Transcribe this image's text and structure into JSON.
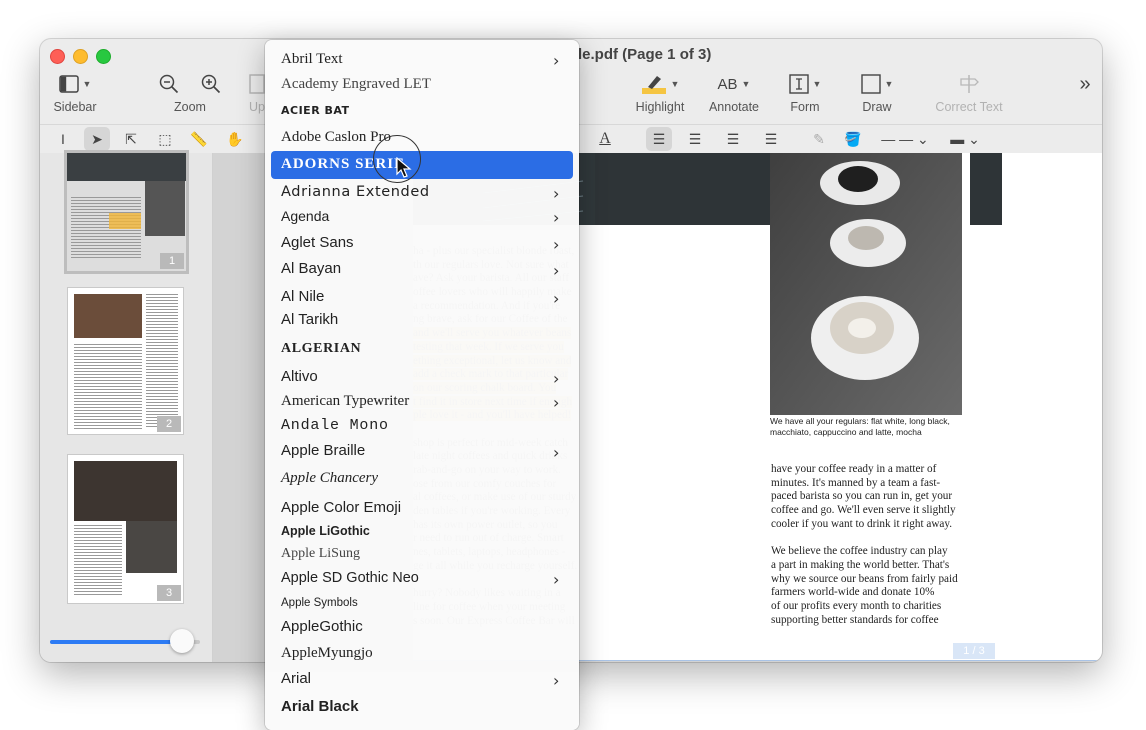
{
  "window": {
    "title": "le.pdf (Page 1 of 3)"
  },
  "toolbar": {
    "sidebar_label": "Sidebar",
    "zoom_label": "Zoom",
    "upload_label": "Up",
    "highlight_label": "Highlight",
    "annotate_label": "Annotate",
    "annotate_icon_text": "AB",
    "form_label": "Form",
    "draw_label": "Draw",
    "correct_text_label": "Correct Text",
    "more_icon": "»"
  },
  "colors": {
    "accent": "#2b6de5",
    "highlight": "#f7c64a",
    "dark_header": "#2e3437"
  },
  "thumbnails": [
    {
      "number": "1",
      "selected": true
    },
    {
      "number": "2",
      "selected": false
    },
    {
      "number": "3",
      "selected": false
    }
  ],
  "thumbnail_zoom_fraction": 0.88,
  "font_menu": {
    "selected_index": 4,
    "items": [
      {
        "label": "Abril Text",
        "submenu": true
      },
      {
        "label": "Academy Engraved LET",
        "submenu": false
      },
      {
        "label": "ACIER BAT",
        "submenu": false
      },
      {
        "label": "Adobe Caslon Pro",
        "submenu": false
      },
      {
        "label": "ADORNS SERIF",
        "submenu": false
      },
      {
        "label": "Adrianna Extended",
        "submenu": true
      },
      {
        "label": "Agenda",
        "submenu": true
      },
      {
        "label": "Aglet Sans",
        "submenu": true
      },
      {
        "label": "Al Bayan",
        "submenu": true
      },
      {
        "label": "Al Nile",
        "submenu": true
      },
      {
        "label": "Al Tarikh",
        "submenu": false
      },
      {
        "label": "ALGERIAN",
        "submenu": false
      },
      {
        "label": "Altivo",
        "submenu": true
      },
      {
        "label": "American Typewriter",
        "submenu": true
      },
      {
        "label": "Andale Mono",
        "submenu": false
      },
      {
        "label": "Apple Braille",
        "submenu": true
      },
      {
        "label": "Apple Chancery",
        "submenu": false
      },
      {
        "label": "Apple Color Emoji",
        "submenu": false
      },
      {
        "label": "Apple LiGothic",
        "submenu": false
      },
      {
        "label": "Apple LiSung",
        "submenu": false
      },
      {
        "label": "Apple SD Gothic Neo",
        "submenu": true
      },
      {
        "label": "Apple Symbols",
        "submenu": false
      },
      {
        "label": "AppleGothic",
        "submenu": false
      },
      {
        "label": "AppleMyungjo",
        "submenu": false
      },
      {
        "label": "Arial",
        "submenu": true
      },
      {
        "label": "Arial Black",
        "submenu": false
      }
    ]
  },
  "document": {
    "left_column": [
      "ha - plus our specialist blonde roast,",
      "th our regulars love. Not sure what",
      "ave? Ask your barista. All our staff",
      "offee lovers who will happily make",
      "a recommendation. And if you're",
      "ng brave, ask for our Coffee of the",
      " and we'll serve you whatever beans",
      " testing that week. If we serve you",
      "ething exceptional, let us know and",
      " add a check mark to that particular",
      " on our scoring chalk board. You",
      "t find it in store next time if enough",
      "ple love it - and you'll have helped!",
      "",
      " shop is perfect for mid-week catch",
      "late night coffees and quick drinks",
      "rab-and-go on your way to work.",
      "ose from our comfy couches for",
      "al coffees, or make use of our sturdy",
      "den tables if you're working. Every",
      " has its own power outlet, so you",
      "r need to run out of charge. Smart",
      "nes, tablets, laptops, headphones -",
      "ge it all while you recharge yourself.",
      "",
      "hurry? Nobody likes waiting in a",
      " line for coffee when your meeting",
      "s soon. Our Express Coffee Bar will"
    ],
    "highlight_range": [
      6,
      12
    ],
    "caption": "We have all your regulars: flat white, long black, macchiato, cappuccino and latte, mocha",
    "right_column": [
      "have your coffee ready in a matter of",
      "minutes. It's manned by a team a fast-",
      "paced barista so you can run in, get your",
      "coffee and go. We'll even serve it slightly",
      "cooler if you want to drink it right away.",
      "",
      "We believe the coffee industry can play",
      "a part in making the world better. That's",
      "why we source our beans from fairly paid",
      "farmers world-wide and donate 10%",
      "of our profits every month to charities",
      "supporting better standards for coffee"
    ],
    "page_indicator": "1 / 3"
  }
}
